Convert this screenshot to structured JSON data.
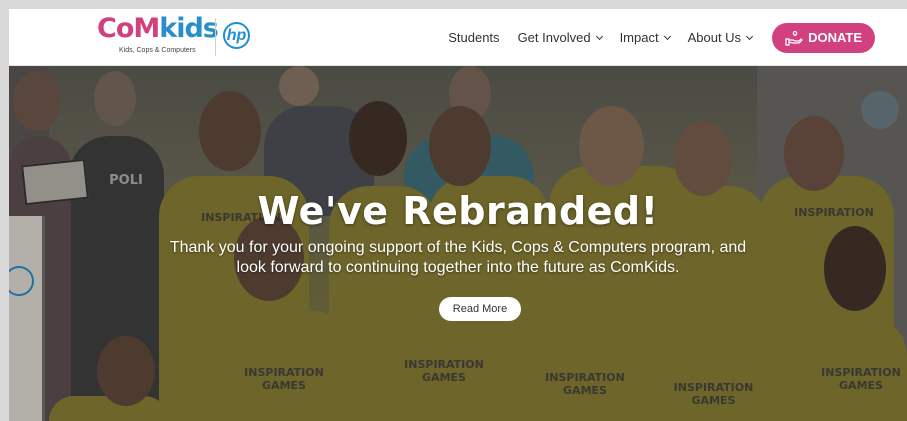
{
  "logo": {
    "brand_part1": "CoM",
    "brand_part2": "kids",
    "tagline": "Kids, Cops & Computers",
    "partner_logo": "hp"
  },
  "nav": {
    "items": [
      {
        "label": "Students",
        "has_dropdown": false
      },
      {
        "label": "Get Involved",
        "has_dropdown": true
      },
      {
        "label": "Impact",
        "has_dropdown": true
      },
      {
        "label": "About Us",
        "has_dropdown": true
      }
    ],
    "donate_label": "DONATE",
    "donate_icon": "hand-heart-icon"
  },
  "hero": {
    "title": "We've Rebranded!",
    "subtitle": "Thank you for your ongoing support of the Kids, Cops & Computers program, and look forward to continuing together into the future as ComKids.",
    "button_label": "Read More",
    "shirt_line1": "INSPIRATION",
    "shirt_line2": "GAMES",
    "police_text": "POLI"
  },
  "colors": {
    "brand_pink": "#d2417f",
    "brand_blue": "#2a8fc9",
    "shirt_yellow": "#c9b83a"
  }
}
